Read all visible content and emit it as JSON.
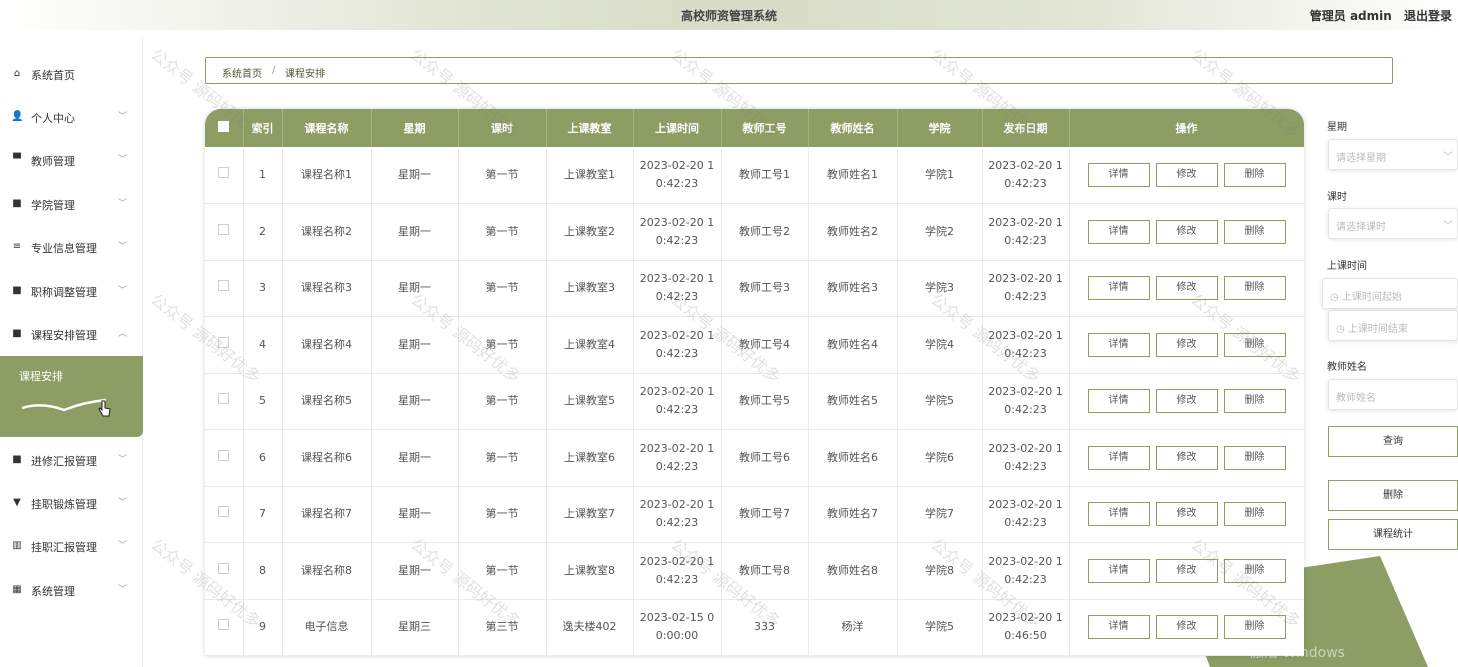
{
  "header": {
    "title": "高校师资管理系统",
    "user_label": "管理员 admin",
    "logout": "退出登录"
  },
  "sidebar": {
    "items": [
      {
        "label": "系统首页",
        "icon": "home-icon",
        "glyph": "⌂",
        "chevron": ""
      },
      {
        "label": "个人中心",
        "icon": "user-icon",
        "glyph": "👤",
        "chevron": "﹀"
      },
      {
        "label": "教师管理",
        "icon": "monitor-icon",
        "glyph": "▀",
        "chevron": "﹀"
      },
      {
        "label": "学院管理",
        "icon": "grid-icon",
        "glyph": "■",
        "chevron": "﹀"
      },
      {
        "label": "专业信息管理",
        "icon": "sliders-icon",
        "glyph": "≡",
        "chevron": "﹀"
      },
      {
        "label": "职称调整管理",
        "icon": "grid-icon",
        "glyph": "■",
        "chevron": "﹀"
      },
      {
        "label": "课程安排管理",
        "icon": "grid-icon",
        "glyph": "■",
        "chevron": "︿"
      },
      {
        "label": "进修汇报管理",
        "icon": "grid-icon",
        "glyph": "■",
        "chevron": "﹀"
      },
      {
        "label": "挂职锻炼管理",
        "icon": "cup-icon",
        "glyph": "▼",
        "chevron": "﹀"
      },
      {
        "label": "挂职汇报管理",
        "icon": "bar-chart-icon",
        "glyph": "▥",
        "chevron": "﹀"
      },
      {
        "label": "系统管理",
        "icon": "apps-icon",
        "glyph": "▦",
        "chevron": "﹀"
      }
    ],
    "submenu_active": "课程安排"
  },
  "breadcrumb": {
    "home": "系统首页",
    "sep": "/",
    "current": "课程安排"
  },
  "table": {
    "headers": [
      "索引",
      "课程名称",
      "星期",
      "课时",
      "上课教室",
      "上课时间",
      "教师工号",
      "教师姓名",
      "学院",
      "发布日期",
      "操作"
    ],
    "actions": {
      "detail": "详情",
      "edit": "修改",
      "delete": "删除"
    },
    "rows": [
      {
        "idx": "1",
        "course": "课程名称1",
        "week": "星期一",
        "period": "第一节",
        "room": "上课教室1",
        "time1": "2023-02-20 1",
        "time2": "0:42:23",
        "tno": "教师工号1",
        "tname": "教师姓名1",
        "college": "学院1",
        "pub1": "2023-02-20 1",
        "pub2": "0:42:23"
      },
      {
        "idx": "2",
        "course": "课程名称2",
        "week": "星期一",
        "period": "第一节",
        "room": "上课教室2",
        "time1": "2023-02-20 1",
        "time2": "0:42:23",
        "tno": "教师工号2",
        "tname": "教师姓名2",
        "college": "学院2",
        "pub1": "2023-02-20 1",
        "pub2": "0:42:23"
      },
      {
        "idx": "3",
        "course": "课程名称3",
        "week": "星期一",
        "period": "第一节",
        "room": "上课教室3",
        "time1": "2023-02-20 1",
        "time2": "0:42:23",
        "tno": "教师工号3",
        "tname": "教师姓名3",
        "college": "学院3",
        "pub1": "2023-02-20 1",
        "pub2": "0:42:23"
      },
      {
        "idx": "4",
        "course": "课程名称4",
        "week": "星期一",
        "period": "第一节",
        "room": "上课教室4",
        "time1": "2023-02-20 1",
        "time2": "0:42:23",
        "tno": "教师工号4",
        "tname": "教师姓名4",
        "college": "学院4",
        "pub1": "2023-02-20 1",
        "pub2": "0:42:23"
      },
      {
        "idx": "5",
        "course": "课程名称5",
        "week": "星期一",
        "period": "第一节",
        "room": "上课教室5",
        "time1": "2023-02-20 1",
        "time2": "0:42:23",
        "tno": "教师工号5",
        "tname": "教师姓名5",
        "college": "学院5",
        "pub1": "2023-02-20 1",
        "pub2": "0:42:23"
      },
      {
        "idx": "6",
        "course": "课程名称6",
        "week": "星期一",
        "period": "第一节",
        "room": "上课教室6",
        "time1": "2023-02-20 1",
        "time2": "0:42:23",
        "tno": "教师工号6",
        "tname": "教师姓名6",
        "college": "学院6",
        "pub1": "2023-02-20 1",
        "pub2": "0:42:23"
      },
      {
        "idx": "7",
        "course": "课程名称7",
        "week": "星期一",
        "period": "第一节",
        "room": "上课教室7",
        "time1": "2023-02-20 1",
        "time2": "0:42:23",
        "tno": "教师工号7",
        "tname": "教师姓名7",
        "college": "学院7",
        "pub1": "2023-02-20 1",
        "pub2": "0:42:23"
      },
      {
        "idx": "8",
        "course": "课程名称8",
        "week": "星期一",
        "period": "第一节",
        "room": "上课教室8",
        "time1": "2023-02-20 1",
        "time2": "0:42:23",
        "tno": "教师工号8",
        "tname": "教师姓名8",
        "college": "学院8",
        "pub1": "2023-02-20 1",
        "pub2": "0:42:23"
      },
      {
        "idx": "9",
        "course": "电子信息",
        "week": "星期三",
        "period": "第三节",
        "room": "逸夫楼402",
        "time1": "2023-02-15 0",
        "time2": "0:00:00",
        "tno": "333",
        "tname": "杨洋",
        "college": "学院5",
        "pub1": "2023-02-20 1",
        "pub2": "0:46:50"
      }
    ]
  },
  "search": {
    "week_label": "星期",
    "week_placeholder": "请选择星期",
    "period_label": "课时",
    "period_placeholder": "请选择课时",
    "time_label": "上课时间",
    "time_start": "上课时间起始",
    "time_end": "上课时间结束",
    "tname_label": "教师姓名",
    "tname_placeholder": "教师姓名",
    "query_btn": "查询",
    "delete_btn": "删除",
    "stats_btn": "课程统计"
  },
  "watermark": "公众号 源码好优多",
  "os_overlay": "激活 Windows",
  "colors": {
    "accent": "#8d9e65",
    "accent_dark": "#6f7f48"
  }
}
